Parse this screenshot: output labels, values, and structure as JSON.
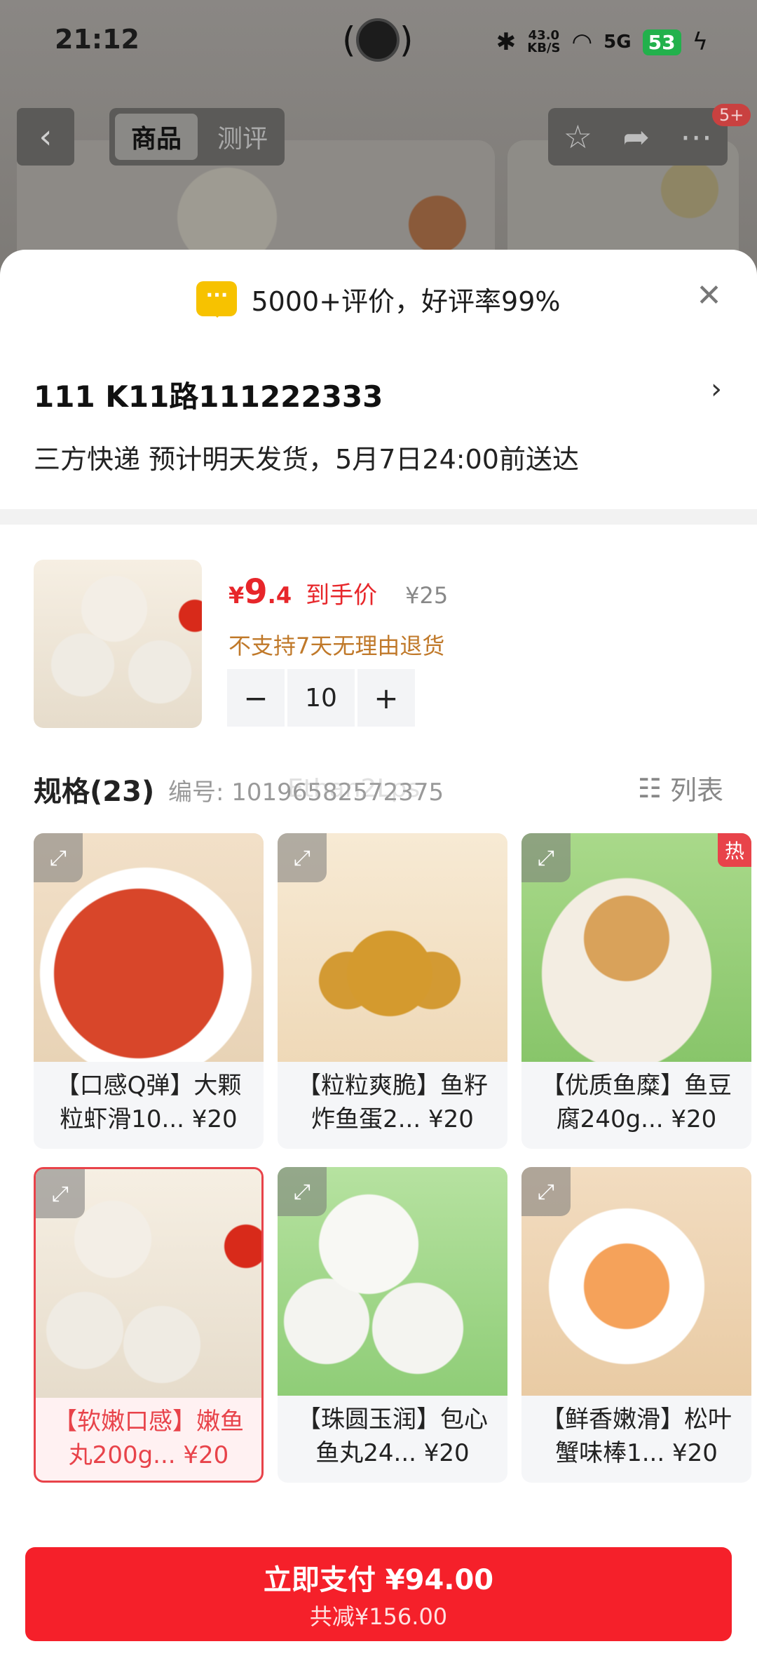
{
  "status_bar": {
    "time": "21:12",
    "net_speed": "43.0",
    "net_unit": "KB/S",
    "signal": "5G",
    "battery": "53"
  },
  "top_nav": {
    "tab_product": "商品",
    "tab_review": "测评",
    "badge": "5+"
  },
  "review_summary": "5000+评价，好评率99%",
  "address": {
    "name": "111  K11路111222333",
    "shipping": "三方快递 预计明天发货，5月7日24:00前送达"
  },
  "product": {
    "yen": "¥",
    "price_int": "9",
    "price_dec": ".4",
    "price_label": "到手价",
    "orig_price": "¥25",
    "notice": "不支持7天无理由退货",
    "quantity": "10",
    "minus": "−",
    "plus": "+"
  },
  "spec": {
    "title": "规格(23)",
    "code": "编号: 10196582572375",
    "view_label": "列表",
    "watermark": "Ethan2Lps",
    "hot_label": "热"
  },
  "spec_items": [
    {
      "line1": "【口感Q弹】大颗",
      "line2": "粒虾滑10... ¥20"
    },
    {
      "line1": "【粒粒爽脆】鱼籽",
      "line2": "炸鱼蛋2... ¥20"
    },
    {
      "line1": "【优质鱼糜】鱼豆",
      "line2": "腐240g... ¥20"
    },
    {
      "line1": "【软嫩口感】嫩鱼",
      "line2": "丸200g... ¥20"
    },
    {
      "line1": "【珠圆玉润】包心",
      "line2": "鱼丸24... ¥20"
    },
    {
      "line1": "【鲜香嫩滑】松叶",
      "line2": "蟹味棒1... ¥20"
    }
  ],
  "pay": {
    "main": "立即支付 ¥94.00",
    "sub": "共减¥156.00"
  },
  "colors": {
    "accent": "#f5202a",
    "price": "#e7262a",
    "notice": "#c0792a"
  }
}
